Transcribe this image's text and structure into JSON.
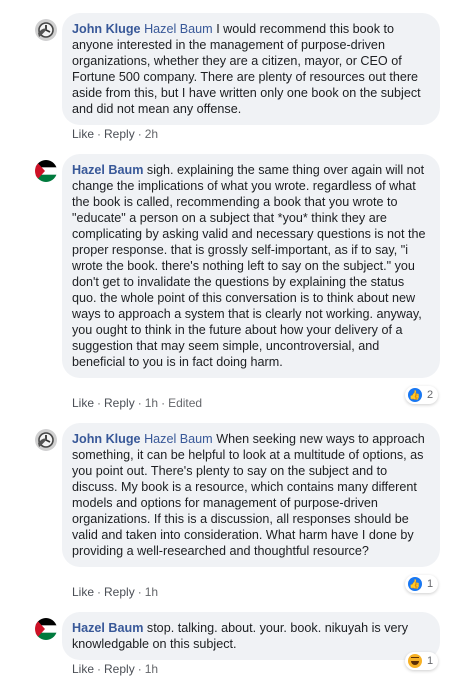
{
  "comments": [
    {
      "author": "John Kluge",
      "mention": "Hazel Baum",
      "avatar_icon": "clock-logo-icon",
      "text": "I would recommend this book to anyone interested in the management of purpose-driven organizations, whether they are a citizen, mayor, or CEO of Fortune 500 company. There are plenty of resources out there aside from this, but I have written only one book on the subject and did not mean any offense.",
      "actions": {
        "like": "Like",
        "reply": "Reply",
        "time": "2h"
      }
    },
    {
      "author": "Hazel Baum",
      "avatar_icon": "palestine-flag-icon",
      "text": "sigh. explaining the same thing over again will not change the implications of what you wrote. regardless of what the book is called, recommending a book that you wrote to \"educate\" a person on a subject that *you* think they are complicating by asking valid and necessary questions is not the proper response. that is grossly self-important, as if to say, \"i wrote the book. there's nothing left to say on the subject.\" you don't get to invalidate the questions by explaining the status quo. the whole point of this conversation is to think about new ways to approach a system that is clearly not working. anyway, you ought to think in the future about how your delivery of a suggestion that may seem simple, uncontroversial, and beneficial to you is in fact doing harm.",
      "actions": {
        "like": "Like",
        "reply": "Reply",
        "time": "1h",
        "edited": "Edited"
      },
      "reaction": {
        "type": "like",
        "count": "2"
      }
    },
    {
      "author": "John Kluge",
      "mention": "Hazel Baum",
      "avatar_icon": "clock-logo-icon",
      "text": "When seeking new ways to approach something, it can be helpful to look at a multitude of options, as you point out. There's plenty to say on the subject and to discuss. My book is a resource, which contains many different models and options for management of purpose-driven organizations. If this is a discussion, all responses should be valid and taken into consideration. What harm have I done by providing a well-researched and thoughtful resource?",
      "actions": {
        "like": "Like",
        "reply": "Reply",
        "time": "1h"
      },
      "reaction": {
        "type": "like",
        "count": "1"
      }
    },
    {
      "author": "Hazel Baum",
      "avatar_icon": "palestine-flag-icon",
      "text": "stop. talking. about. your. book. nikuyah is very knowledgable on this subject.",
      "actions": {
        "like": "Like",
        "reply": "Reply",
        "time": "1h"
      },
      "reaction": {
        "type": "haha",
        "count": "1"
      }
    }
  ],
  "colors": {
    "author": "#385898",
    "bubble": "#f0f2f5",
    "like_blue": "#1877f2",
    "flag_red": "#ce1126",
    "flag_green": "#007a3d"
  }
}
